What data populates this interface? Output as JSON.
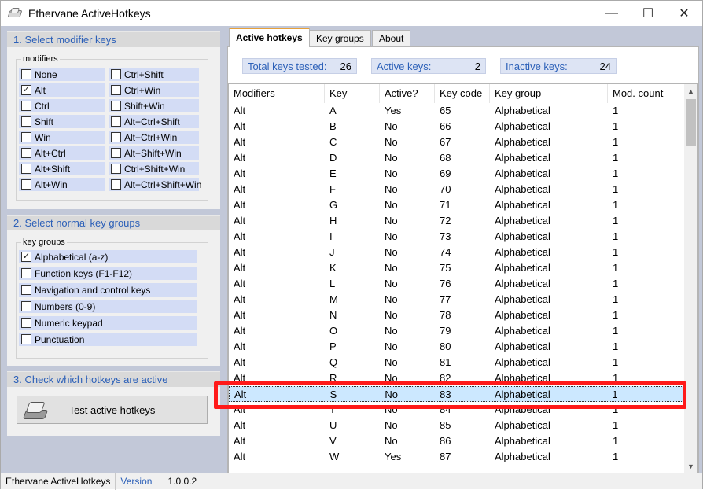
{
  "window": {
    "title": "Ethervane ActiveHotkeys",
    "icon": "keyboard-key-icon"
  },
  "controls": {
    "minimize": "—",
    "maximize": "☐",
    "close": "✕"
  },
  "modifier_section": {
    "title": "1. Select modifier keys",
    "group_label": "modifiers",
    "left_items": [
      {
        "label": "None",
        "checked": false
      },
      {
        "label": "Alt",
        "checked": true
      },
      {
        "label": "Ctrl",
        "checked": false
      },
      {
        "label": "Shift",
        "checked": false
      },
      {
        "label": "Win",
        "checked": false
      },
      {
        "label": "Alt+Ctrl",
        "checked": false
      },
      {
        "label": "Alt+Shift",
        "checked": false
      },
      {
        "label": "Alt+Win",
        "checked": false
      }
    ],
    "right_items": [
      {
        "label": "Ctrl+Shift",
        "checked": false
      },
      {
        "label": "Ctrl+Win",
        "checked": false
      },
      {
        "label": "Shift+Win",
        "checked": false
      },
      {
        "label": "Alt+Ctrl+Shift",
        "checked": false
      },
      {
        "label": "Alt+Ctrl+Win",
        "checked": false
      },
      {
        "label": "Alt+Shift+Win",
        "checked": false
      },
      {
        "label": "Ctrl+Shift+Win",
        "checked": false
      },
      {
        "label": "Alt+Ctrl+Shift+Win",
        "checked": false
      }
    ]
  },
  "keygroup_section": {
    "title": "2. Select normal key groups",
    "group_label": "key groups",
    "items": [
      {
        "label": "Alphabetical (a-z)",
        "checked": true
      },
      {
        "label": "Function keys (F1-F12)",
        "checked": false
      },
      {
        "label": "Navigation and control keys",
        "checked": false
      },
      {
        "label": "Numbers (0-9)",
        "checked": false
      },
      {
        "label": "Numeric keypad",
        "checked": false
      },
      {
        "label": "Punctuation",
        "checked": false
      }
    ]
  },
  "check_section": {
    "title": "3. Check which hotkeys are active",
    "button_label": "Test active hotkeys",
    "button_icon": "keyboard-key-icon"
  },
  "tabs": [
    {
      "label": "Active hotkeys",
      "active": true
    },
    {
      "label": "Key groups",
      "active": false
    },
    {
      "label": "About",
      "active": false
    }
  ],
  "stats": {
    "total_label": "Total keys tested:",
    "total_value": "26",
    "active_label": "Active keys:",
    "active_value": "2",
    "inactive_label": "Inactive keys:",
    "inactive_value": "24"
  },
  "table": {
    "headers": [
      "Modifiers",
      "Key",
      "Active?",
      "Key code",
      "Key group",
      "Mod. count"
    ],
    "rows": [
      [
        "Alt",
        "A",
        "Yes",
        "65",
        "Alphabetical",
        "1"
      ],
      [
        "Alt",
        "B",
        "No",
        "66",
        "Alphabetical",
        "1"
      ],
      [
        "Alt",
        "C",
        "No",
        "67",
        "Alphabetical",
        "1"
      ],
      [
        "Alt",
        "D",
        "No",
        "68",
        "Alphabetical",
        "1"
      ],
      [
        "Alt",
        "E",
        "No",
        "69",
        "Alphabetical",
        "1"
      ],
      [
        "Alt",
        "F",
        "No",
        "70",
        "Alphabetical",
        "1"
      ],
      [
        "Alt",
        "G",
        "No",
        "71",
        "Alphabetical",
        "1"
      ],
      [
        "Alt",
        "H",
        "No",
        "72",
        "Alphabetical",
        "1"
      ],
      [
        "Alt",
        "I",
        "No",
        "73",
        "Alphabetical",
        "1"
      ],
      [
        "Alt",
        "J",
        "No",
        "74",
        "Alphabetical",
        "1"
      ],
      [
        "Alt",
        "K",
        "No",
        "75",
        "Alphabetical",
        "1"
      ],
      [
        "Alt",
        "L",
        "No",
        "76",
        "Alphabetical",
        "1"
      ],
      [
        "Alt",
        "M",
        "No",
        "77",
        "Alphabetical",
        "1"
      ],
      [
        "Alt",
        "N",
        "No",
        "78",
        "Alphabetical",
        "1"
      ],
      [
        "Alt",
        "O",
        "No",
        "79",
        "Alphabetical",
        "1"
      ],
      [
        "Alt",
        "P",
        "No",
        "80",
        "Alphabetical",
        "1"
      ],
      [
        "Alt",
        "Q",
        "No",
        "81",
        "Alphabetical",
        "1"
      ],
      [
        "Alt",
        "R",
        "No",
        "82",
        "Alphabetical",
        "1"
      ],
      [
        "Alt",
        "S",
        "No",
        "83",
        "Alphabetical",
        "1"
      ],
      [
        "Alt",
        "T",
        "No",
        "84",
        "Alphabetical",
        "1"
      ],
      [
        "Alt",
        "U",
        "No",
        "85",
        "Alphabetical",
        "1"
      ],
      [
        "Alt",
        "V",
        "No",
        "86",
        "Alphabetical",
        "1"
      ],
      [
        "Alt",
        "W",
        "Yes",
        "87",
        "Alphabetical",
        "1"
      ]
    ],
    "selected_row": 18
  },
  "statusbar": {
    "app_name": "Ethervane ActiveHotkeys",
    "version_label": "Version",
    "version_value": "1.0.0.2"
  },
  "colors": {
    "accent_blue": "#2c60b8",
    "left_bg": "#c2c8d8",
    "checkbox_row_bg": "#d3dcf5",
    "selection_bg": "#cce8ff",
    "highlight_red": "#ff1a1a",
    "active_tab_accent": "#e6a03a"
  }
}
